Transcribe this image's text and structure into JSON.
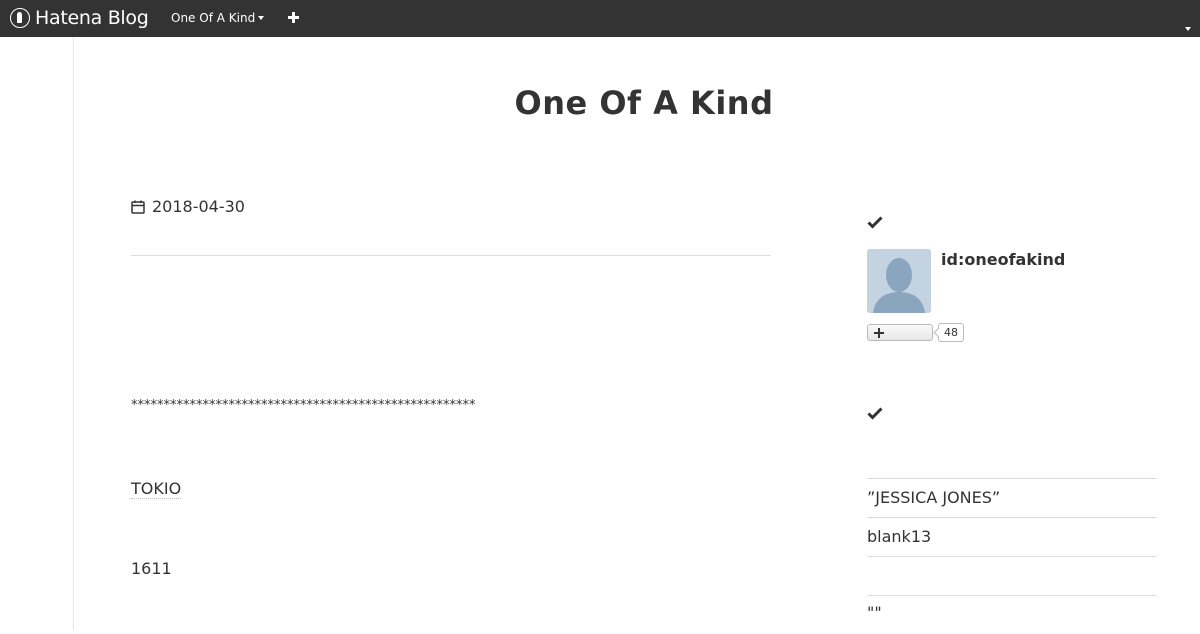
{
  "header": {
    "logo_text": "Hatena Blog",
    "blog_menu_label": "One Of A Kind",
    "colors": {
      "bar_background": "#333333",
      "bar_text": "#ffffff"
    },
    "icons": [
      "hatena-logo-icon",
      "caret-down-icon",
      "plus-icon",
      "user-menu-caret-icon"
    ]
  },
  "blog": {
    "title": "One Of A Kind"
  },
  "article": {
    "date": "2018-04-30",
    "stars_line": "*****************************************************",
    "keyword": "TOKIO",
    "paragraph_number": "1611"
  },
  "sidebar": {
    "profile": {
      "id_label": "id:oneofakind",
      "follower_count": "48",
      "icons": [
        "check-icon",
        "avatar-silhouette-icon",
        "plus-icon"
      ]
    },
    "section2": {
      "icons": [
        "check-icon"
      ],
      "items": [
        {
          "label": "”JESSICA JONES”"
        },
        {
          "label": "blank13"
        },
        {
          "label": ""
        },
        {
          "label": "\"\""
        }
      ]
    }
  }
}
